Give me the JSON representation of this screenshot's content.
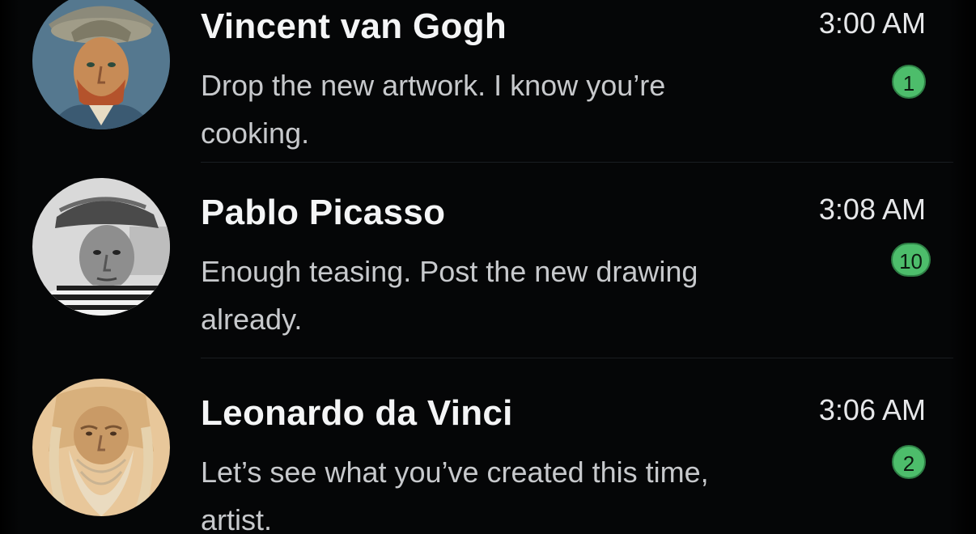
{
  "chats": [
    {
      "name": "Vincent van Gogh",
      "preview": "Drop the new artwork. I know you’re cooking.",
      "time": "3:00 AM",
      "unread": "1",
      "avatar": "van-gogh-portrait"
    },
    {
      "name": "Pablo Picasso",
      "preview": "Enough teasing. Post the new drawing already.",
      "time": "3:08 AM",
      "unread": "10",
      "avatar": "picasso-portrait"
    },
    {
      "name": "Leonardo da Vinci",
      "preview": "Let’s see what you’ve created this time, artist.",
      "time": "3:06 AM",
      "unread": "2",
      "avatar": "da-vinci-portrait"
    }
  ],
  "colors": {
    "background": "#050607",
    "unread_badge": "#4dbd6b",
    "name_text": "#f4f5f6",
    "preview_text": "#c7c9cc"
  }
}
